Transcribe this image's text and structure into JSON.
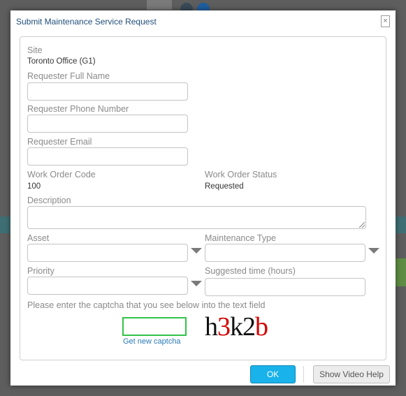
{
  "dialog": {
    "title": "Submit Maintenance Service Request",
    "close_glyph": "×"
  },
  "form": {
    "site": {
      "label": "Site",
      "value": "Toronto Office (G1)"
    },
    "requester_full_name": {
      "label": "Requester Full Name",
      "value": ""
    },
    "requester_phone": {
      "label": "Requester Phone Number",
      "value": ""
    },
    "requester_email": {
      "label": "Requester Email",
      "value": ""
    },
    "work_order_code": {
      "label": "Work Order Code",
      "value": "100"
    },
    "work_order_status": {
      "label": "Work Order Status",
      "value": "Requested"
    },
    "description": {
      "label": "Description",
      "value": ""
    },
    "asset": {
      "label": "Asset",
      "value": ""
    },
    "maintenance_type": {
      "label": "Maintenance Type",
      "value": ""
    },
    "priority": {
      "label": "Priority",
      "value": ""
    },
    "suggested_time": {
      "label": "Suggested time (hours)",
      "value": ""
    },
    "captcha": {
      "instruction": "Please enter the captcha that you see below into the text field",
      "value": "",
      "new_link": "Get new captcha",
      "chars": [
        {
          "char": "h",
          "color": "#111111"
        },
        {
          "char": "3",
          "color": "#d40000"
        },
        {
          "char": "k",
          "color": "#111111"
        },
        {
          "char": "2",
          "color": "#111111"
        },
        {
          "char": "b",
          "color": "#d40000"
        }
      ]
    }
  },
  "buttons": {
    "ok": "OK",
    "video_help": "Show Video Help"
  },
  "colors": {
    "title": "#1f4e79",
    "ok_button": "#19b2ea",
    "captcha_border": "#33c24a",
    "link": "#2a7ab5"
  }
}
